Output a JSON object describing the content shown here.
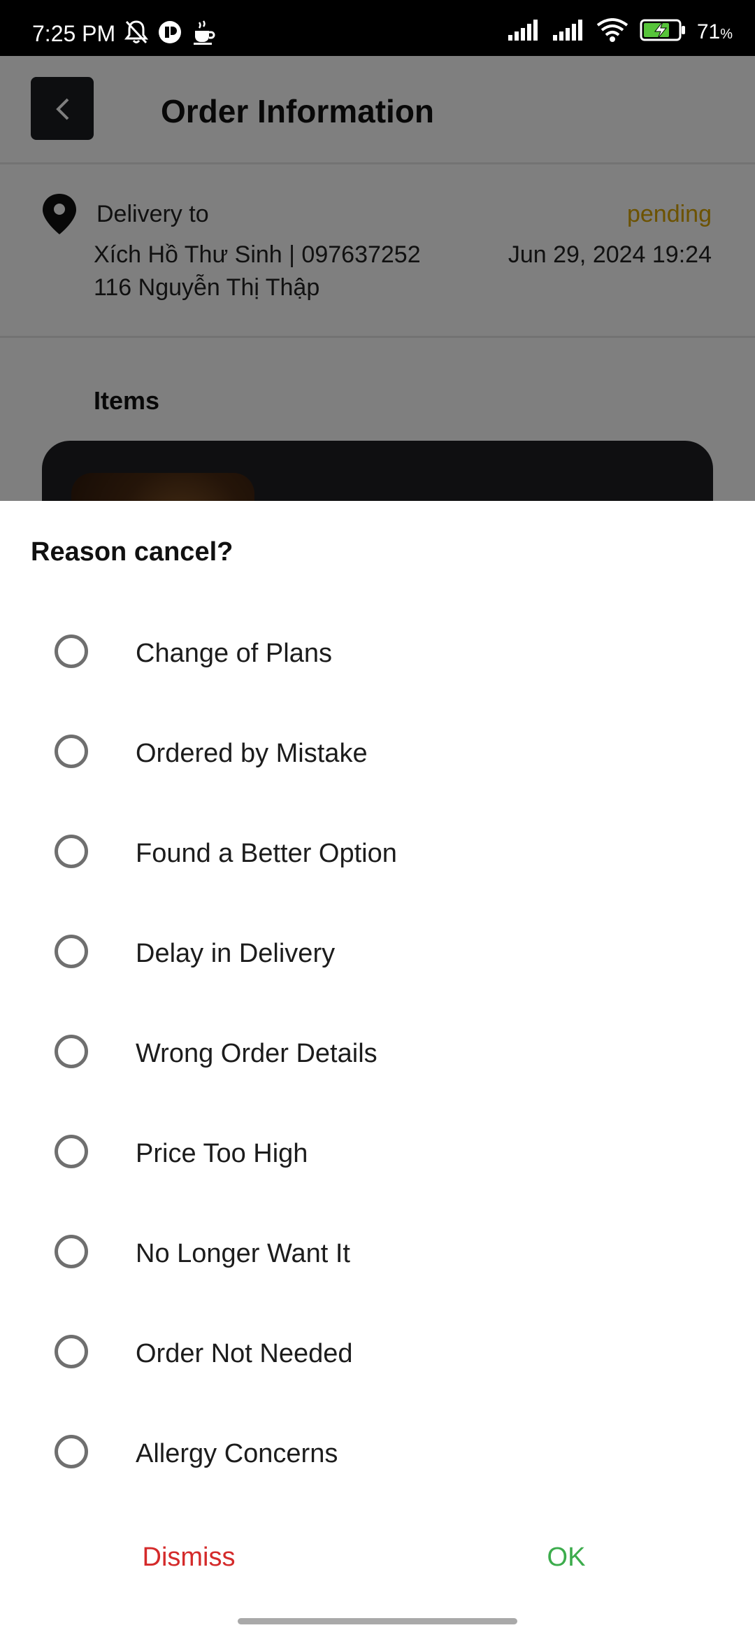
{
  "status_bar": {
    "time": "7:25 PM",
    "battery": "71",
    "battery_unit": "%",
    "icons": [
      "mute-icon",
      "app-icon",
      "coffee-icon",
      "signal-icon",
      "signal-icon",
      "wifi-icon",
      "battery-charging-icon"
    ]
  },
  "header": {
    "title": "Order Information",
    "back_icon": "chevron-left-icon"
  },
  "delivery": {
    "label": "Delivery to",
    "status": "pending",
    "recipient": "Xích Hồ Thư Sinh | 097637252",
    "date": "Jun 29, 2024 19:24",
    "address": "116 Nguyễn Thị Thập",
    "icon": "location-pin-icon"
  },
  "items": {
    "heading": "Items"
  },
  "dialog": {
    "title": "Reason cancel?",
    "options": [
      {
        "label": "Change of Plans",
        "selected": false
      },
      {
        "label": "Ordered by Mistake",
        "selected": false
      },
      {
        "label": "Found a Better Option",
        "selected": false
      },
      {
        "label": "Delay in Delivery",
        "selected": false
      },
      {
        "label": "Wrong Order Details",
        "selected": false
      },
      {
        "label": "Price Too High",
        "selected": false
      },
      {
        "label": "No Longer Want It",
        "selected": false
      },
      {
        "label": "Order Not Needed",
        "selected": false
      },
      {
        "label": "Allergy Concerns",
        "selected": false
      }
    ],
    "dismiss_label": "Dismiss",
    "ok_label": "OK"
  },
  "colors": {
    "pending": "#d8a400",
    "dismiss": "#d42a2a",
    "ok": "#3cac4c"
  }
}
